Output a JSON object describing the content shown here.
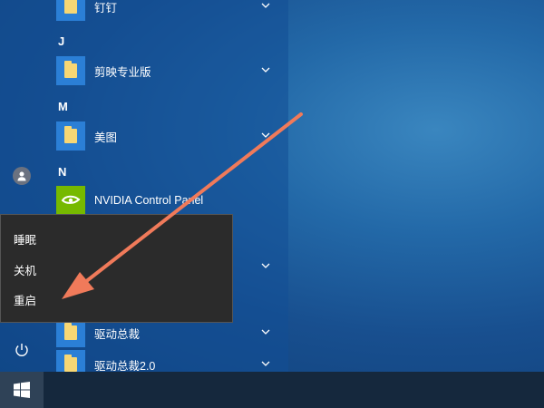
{
  "start_menu": {
    "apps": [
      {
        "label": "钉钉",
        "icon": "folder-icon"
      },
      {
        "label": "剪映专业版",
        "icon": "folder-icon"
      },
      {
        "label": "美图",
        "icon": "folder-icon"
      },
      {
        "label": "NVIDIA Control Panel",
        "icon": "nvidia-icon"
      },
      {
        "label": "",
        "icon": "folder-icon"
      },
      {
        "label": "驱动总裁",
        "icon": "folder-icon"
      },
      {
        "label": "驱动总裁2.0",
        "icon": "folder-icon"
      }
    ],
    "letters": [
      "J",
      "M",
      "N"
    ]
  },
  "power_menu": {
    "items": [
      "睡眠",
      "关机",
      "重启"
    ]
  },
  "colors": {
    "accent_arrow": "#f07a5a",
    "tile_blue": "#2b7fd6",
    "nvidia_green": "#76b900",
    "popup_bg": "#2b2b2b"
  }
}
